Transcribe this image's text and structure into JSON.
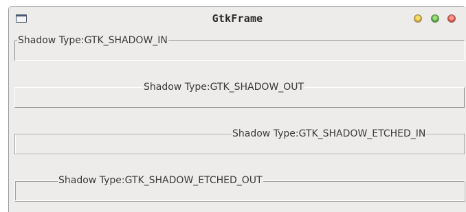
{
  "window": {
    "title": "GtkFrame"
  },
  "frames": [
    {
      "label": "Shadow Type:GTK_SHADOW_IN"
    },
    {
      "label": "Shadow Type:GTK_SHADOW_OUT"
    },
    {
      "label": "Shadow Type:GTK_SHADOW_ETCHED_IN"
    },
    {
      "label": "Shadow Type:GTK_SHADOW_ETCHED_OUT"
    }
  ]
}
